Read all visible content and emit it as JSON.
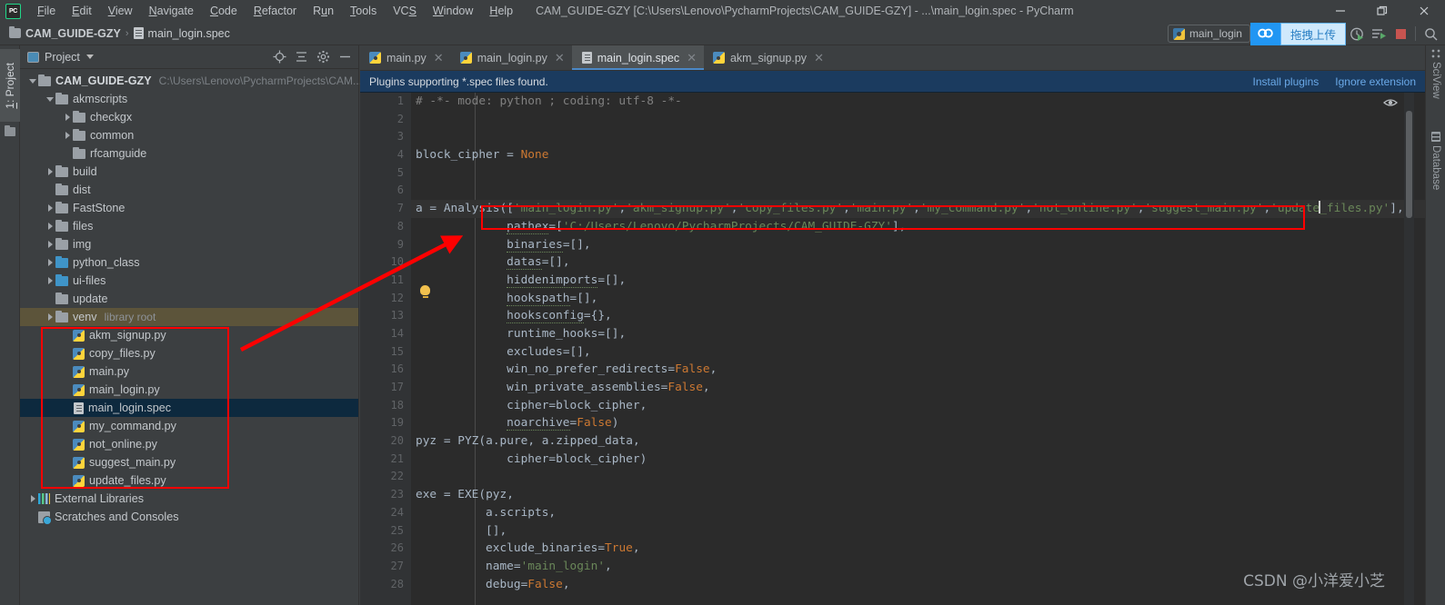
{
  "window": {
    "title": "CAM_GUIDE-GZY [C:\\Users\\Lenovo\\PycharmProjects\\CAM_GUIDE-GZY] - ...\\main_login.spec - PyCharm",
    "logo_text": "PC",
    "minimize": "—",
    "maximize": "❐",
    "close": "✕"
  },
  "menu": [
    {
      "label": "File"
    },
    {
      "label": "Edit"
    },
    {
      "label": "View"
    },
    {
      "label": "Navigate"
    },
    {
      "label": "Code"
    },
    {
      "label": "Refactor"
    },
    {
      "label": "Run"
    },
    {
      "label": "Tools"
    },
    {
      "label": "VCS"
    },
    {
      "label": "Window"
    },
    {
      "label": "Help"
    }
  ],
  "breadcrumb": {
    "project": "CAM_GUIDE-GZY",
    "separator": "›",
    "file": "main_login.spec"
  },
  "toolbar": {
    "run_config": "main_login",
    "netdisk_icon": "baidu-netdisk-icon",
    "netdisk_tip": "拖拽上传",
    "run_icon": "run-with-coverage-icon",
    "runtool_icon": "run-tool-icon",
    "stop_icon": "stop-icon",
    "search_icon": "search-icon",
    "accent_blue": "#2196f3",
    "stop_red": "#c75450"
  },
  "left_strip": {
    "project_tab": "1: Project",
    "structure_icon": "folder-icon"
  },
  "right_strip": [
    {
      "label": "SciView",
      "icon": "grid-icon"
    },
    {
      "label": "Database",
      "icon": "database-icon"
    }
  ],
  "project_panel": {
    "title": "Project",
    "actions": [
      "target-icon",
      "collapse-all-icon",
      "settings-gear-icon",
      "hide-icon"
    ],
    "tree": [
      {
        "indent": 0,
        "arrow": "open",
        "icon": "folder",
        "name": "CAM_GUIDE-GZY",
        "bold": true,
        "path": "C:\\Users\\Lenovo\\PycharmProjects\\CAM...",
        "state": "normal"
      },
      {
        "indent": 1,
        "arrow": "open",
        "icon": "folder",
        "name": "akmscripts",
        "bold": false,
        "path": "",
        "state": "normal"
      },
      {
        "indent": 2,
        "arrow": "closed",
        "icon": "folder",
        "name": "checkgx",
        "bold": false,
        "path": "",
        "state": "normal"
      },
      {
        "indent": 2,
        "arrow": "closed",
        "icon": "folder",
        "name": "common",
        "bold": false,
        "path": "",
        "state": "normal"
      },
      {
        "indent": 2,
        "arrow": "none",
        "icon": "folder",
        "name": "rfcamguide",
        "bold": false,
        "path": "",
        "state": "normal"
      },
      {
        "indent": 1,
        "arrow": "closed",
        "icon": "folder",
        "name": "build",
        "bold": false,
        "path": "",
        "state": "normal"
      },
      {
        "indent": 1,
        "arrow": "none",
        "icon": "folder",
        "name": "dist",
        "bold": false,
        "path": "",
        "state": "normal"
      },
      {
        "indent": 1,
        "arrow": "closed",
        "icon": "folder",
        "name": "FastStone",
        "bold": false,
        "path": "",
        "state": "normal"
      },
      {
        "indent": 1,
        "arrow": "closed",
        "icon": "folder",
        "name": "files",
        "bold": false,
        "path": "",
        "state": "normal"
      },
      {
        "indent": 1,
        "arrow": "closed",
        "icon": "folder",
        "name": "img",
        "bold": false,
        "path": "",
        "state": "normal"
      },
      {
        "indent": 1,
        "arrow": "closed",
        "icon": "folderblue",
        "name": "python_class",
        "bold": false,
        "path": "",
        "state": "normal"
      },
      {
        "indent": 1,
        "arrow": "closed",
        "icon": "folderblue",
        "name": "ui-files",
        "bold": false,
        "path": "",
        "state": "normal"
      },
      {
        "indent": 1,
        "arrow": "none",
        "icon": "folder",
        "name": "update",
        "bold": false,
        "path": "",
        "state": "normal"
      },
      {
        "indent": 1,
        "arrow": "closed",
        "icon": "folder",
        "name": "venv",
        "bold": false,
        "path": "library root",
        "state": "venv"
      },
      {
        "indent": 2,
        "arrow": "none",
        "icon": "py",
        "name": "akm_signup.py",
        "bold": false,
        "path": "",
        "state": "normal"
      },
      {
        "indent": 2,
        "arrow": "none",
        "icon": "py",
        "name": "copy_files.py",
        "bold": false,
        "path": "",
        "state": "normal"
      },
      {
        "indent": 2,
        "arrow": "none",
        "icon": "py",
        "name": "main.py",
        "bold": false,
        "path": "",
        "state": "normal"
      },
      {
        "indent": 2,
        "arrow": "none",
        "icon": "py",
        "name": "main_login.py",
        "bold": false,
        "path": "",
        "state": "normal"
      },
      {
        "indent": 2,
        "arrow": "none",
        "icon": "spec",
        "name": "main_login.spec",
        "bold": false,
        "path": "",
        "state": "selected"
      },
      {
        "indent": 2,
        "arrow": "none",
        "icon": "py",
        "name": "my_command.py",
        "bold": false,
        "path": "",
        "state": "normal"
      },
      {
        "indent": 2,
        "arrow": "none",
        "icon": "py",
        "name": "not_online.py",
        "bold": false,
        "path": "",
        "state": "normal"
      },
      {
        "indent": 2,
        "arrow": "none",
        "icon": "py",
        "name": "suggest_main.py",
        "bold": false,
        "path": "",
        "state": "normal"
      },
      {
        "indent": 2,
        "arrow": "none",
        "icon": "py",
        "name": "update_files.py",
        "bold": false,
        "path": "",
        "state": "normal"
      },
      {
        "indent": 0,
        "arrow": "closed",
        "icon": "extlib",
        "name": "External Libraries",
        "bold": false,
        "path": "",
        "state": "normal"
      },
      {
        "indent": 0,
        "arrow": "none",
        "icon": "scratch",
        "name": "Scratches and Consoles",
        "bold": false,
        "path": "",
        "state": "normal"
      }
    ]
  },
  "editor": {
    "tabs": [
      {
        "label": "main.py",
        "icon": "python-file-icon",
        "active": false,
        "close": "✕"
      },
      {
        "label": "main_login.py",
        "icon": "python-file-icon",
        "active": false,
        "close": "✕"
      },
      {
        "label": "main_login.spec",
        "icon": "spec-file-icon",
        "active": true,
        "close": "✕"
      },
      {
        "label": "akm_signup.py",
        "icon": "python-file-icon",
        "active": false,
        "close": "✕"
      }
    ],
    "notification": {
      "message": "Plugins supporting *.spec files found.",
      "install_link": "Install plugins",
      "ignore_link": "Ignore extension"
    },
    "line_numbers": [
      1,
      2,
      3,
      4,
      5,
      6,
      7,
      8,
      9,
      10,
      11,
      12,
      13,
      14,
      15,
      16,
      17,
      18,
      19,
      20,
      21,
      22,
      23,
      24,
      25,
      26,
      27,
      28
    ],
    "code": [
      "# -*- mode: python ; coding: utf-8 -*-",
      "",
      "",
      "block_cipher = None",
      "",
      "",
      "a = Analysis(['main_login.py','akm_signup.py','copy_files.py','main.py','my_command.py','not_online.py','suggest_main.py','update_files.py'],",
      "             pathex=['C:/Users/Lenovo/PycharmProjects/CAM_GUIDE-GZY'],",
      "             binaries=[],",
      "             datas=[],",
      "             hiddenimports=[],",
      "             hookspath=[],",
      "             hooksconfig={},",
      "             runtime_hooks=[],",
      "             excludes=[],",
      "             win_no_prefer_redirects=False,",
      "             win_private_assemblies=False,",
      "             cipher=block_cipher,",
      "             noarchive=False)",
      "pyz = PYZ(a.pure, a.zipped_data,",
      "             cipher=block_cipher)",
      "",
      "exe = EXE(pyz,",
      "          a.scripts,",
      "          [],",
      "          exclude_binaries=True,",
      "          name='main_login',",
      "          debug=False,"
    ],
    "eye_icon": "inspections-eye-icon",
    "caret_line": 7
  },
  "watermark": "CSDN @小洋爱小芝",
  "annotations": {
    "highlight_color": "#fe0000",
    "boxes": [
      "code-line-7-box",
      "project-files-box"
    ],
    "arrow": "red-arrow-pointer"
  }
}
